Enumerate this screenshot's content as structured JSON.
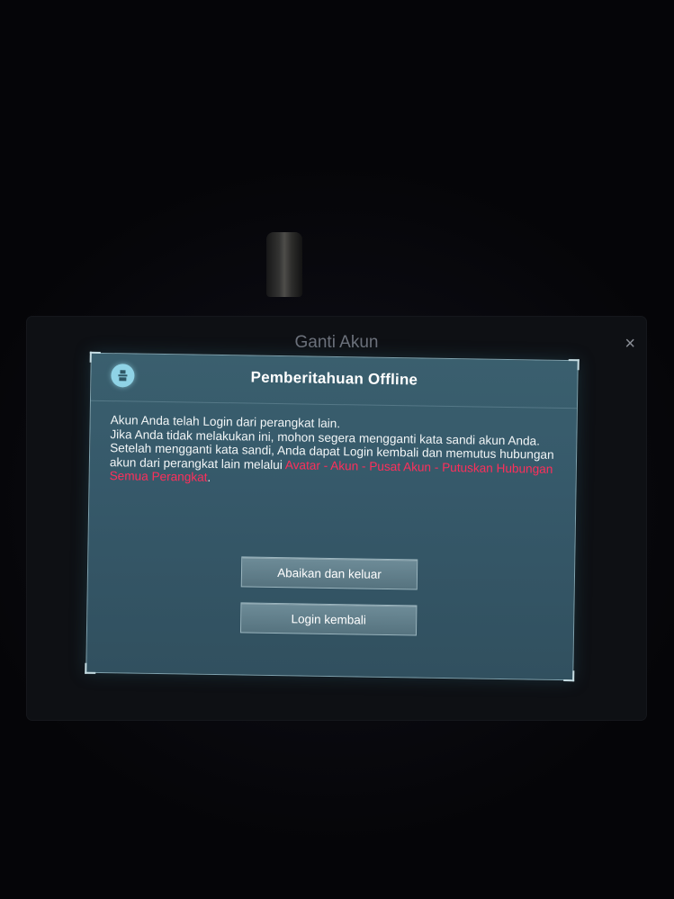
{
  "background_window": {
    "title": "Ganti Akun",
    "close_glyph": "×"
  },
  "dialog": {
    "icon": "game-logo-icon",
    "title": "Pemberitahuan Offline",
    "lines": [
      "Akun Anda telah Login dari perangkat lain.",
      "Jika Anda tidak melakukan ini, mohon segera mengganti kata sandi akun Anda.",
      "Setelah mengganti kata sandi, Anda dapat Login kembali dan memutus hubungan akun dari perangkat lain melalui"
    ],
    "highlight_path": "Avatar - Akun - Pusat Akun - Putuskan Hubungan Semua Perangkat",
    "highlight_suffix": ".",
    "buttons": {
      "ignore_exit": "Abaikan dan keluar",
      "login_again": "Login kembali"
    }
  },
  "colors": {
    "dialog_bg": "#36596a",
    "highlight": "#ff2f5b",
    "button_bg": "#627f8b"
  }
}
